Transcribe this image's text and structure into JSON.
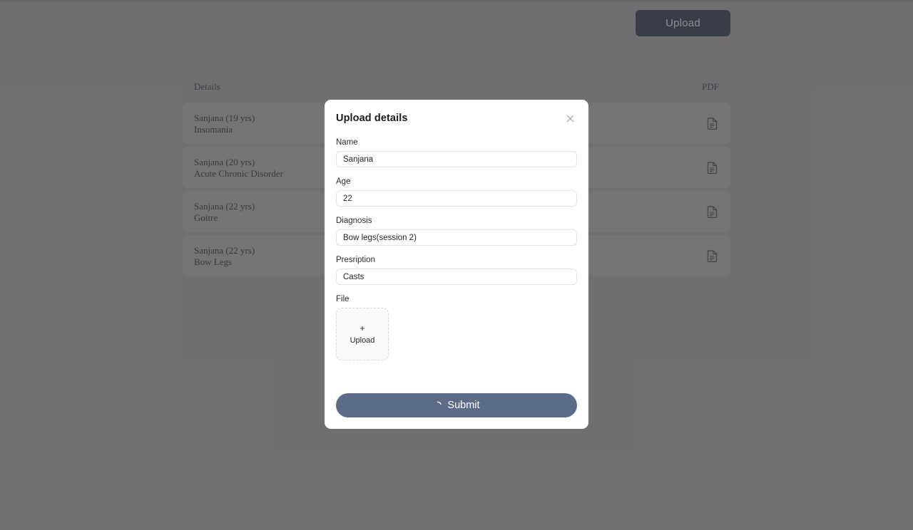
{
  "toolbar": {
    "upload_label": "Upload",
    "upload_bg": "#111b2e",
    "upload_fg": "#c9ccd2"
  },
  "records": {
    "columns": {
      "details": "Details",
      "pdf": "PDF"
    },
    "row_icon": "document-icon",
    "rows": [
      {
        "patient": "Sanjana (19 yrs)",
        "condition": "Insomania"
      },
      {
        "patient": "Sanjana (20 yrs)",
        "condition": "Acute Chronic Disorder"
      },
      {
        "patient": "Sanjana (22 yrs)",
        "condition": "Goitre"
      },
      {
        "patient": "Sanjana (22 yrs)",
        "condition": "Bow Legs"
      }
    ]
  },
  "modal": {
    "title": "Upload details",
    "close_icon": "close-icon",
    "fields": [
      {
        "label": "Name",
        "value": "Sanjana",
        "placeholder": "Name"
      },
      {
        "label": "Age",
        "value": "22",
        "placeholder": "Age"
      },
      {
        "label": "Diagnosis",
        "value": "Bow legs(session 2)",
        "placeholder": "Diagnosis"
      },
      {
        "label": "Presription",
        "value": "Casts",
        "placeholder": "Presription"
      }
    ],
    "file": {
      "label": "File",
      "plus": "+",
      "upload_label": "Upload",
      "plus_icon": "plus-icon"
    },
    "submit": {
      "label": "Submit",
      "loading": true,
      "spinner_icon": "spinner-icon",
      "bg": "#5c6c88",
      "fg": "#ffffff"
    }
  }
}
